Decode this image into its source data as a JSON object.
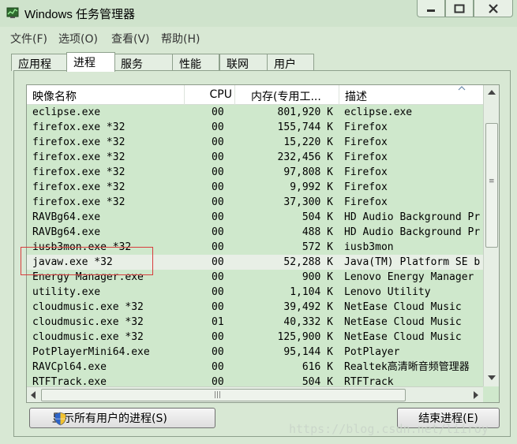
{
  "window": {
    "title": "Windows 任务管理器",
    "icon": "task-manager-icon"
  },
  "menu": [
    "文件(F)",
    "选项(O)",
    "查看(V)",
    "帮助(H)"
  ],
  "tabs": [
    "应用程序",
    "进程",
    "服务",
    "性能",
    "联网",
    "用户"
  ],
  "active_tab": "进程",
  "columns": [
    "映像名称",
    "CPU",
    "内存(专用工...",
    "描述"
  ],
  "rows": [
    {
      "name": "eclipse.exe",
      "cpu": "00",
      "mem": "801,920 K",
      "desc": "eclipse.exe"
    },
    {
      "name": "firefox.exe *32",
      "cpu": "00",
      "mem": "155,744 K",
      "desc": "Firefox"
    },
    {
      "name": "firefox.exe *32",
      "cpu": "00",
      "mem": "15,220 K",
      "desc": "Firefox"
    },
    {
      "name": "firefox.exe *32",
      "cpu": "00",
      "mem": "232,456 K",
      "desc": "Firefox"
    },
    {
      "name": "firefox.exe *32",
      "cpu": "00",
      "mem": "97,808 K",
      "desc": "Firefox"
    },
    {
      "name": "firefox.exe *32",
      "cpu": "00",
      "mem": "9,992 K",
      "desc": "Firefox"
    },
    {
      "name": "firefox.exe *32",
      "cpu": "00",
      "mem": "37,300 K",
      "desc": "Firefox"
    },
    {
      "name": "RAVBg64.exe",
      "cpu": "00",
      "mem": "504 K",
      "desc": "HD Audio Background Pr"
    },
    {
      "name": "RAVBg64.exe",
      "cpu": "00",
      "mem": "488 K",
      "desc": "HD Audio Background Pr"
    },
    {
      "name": "iusb3mon.exe *32",
      "cpu": "00",
      "mem": "572 K",
      "desc": "iusb3mon"
    },
    {
      "name": "javaw.exe *32",
      "cpu": "00",
      "mem": "52,288 K",
      "desc": "Java(TM) Platform SE b"
    },
    {
      "name": "Energy Manager.exe",
      "cpu": "00",
      "mem": "900 K",
      "desc": "Lenovo Energy Manager"
    },
    {
      "name": "utility.exe",
      "cpu": "00",
      "mem": "1,104 K",
      "desc": "Lenovo Utility"
    },
    {
      "name": "cloudmusic.exe *32",
      "cpu": "00",
      "mem": "39,492 K",
      "desc": "NetEase Cloud Music"
    },
    {
      "name": "cloudmusic.exe *32",
      "cpu": "01",
      "mem": "40,332 K",
      "desc": "NetEase Cloud Music"
    },
    {
      "name": "cloudmusic.exe *32",
      "cpu": "00",
      "mem": "125,900 K",
      "desc": "NetEase Cloud Music"
    },
    {
      "name": "PotPlayerMini64.exe",
      "cpu": "00",
      "mem": "95,144 K",
      "desc": "PotPlayer"
    },
    {
      "name": "RAVCpl64.exe",
      "cpu": "00",
      "mem": "616 K",
      "desc": "Realtek高清晰音频管理器"
    },
    {
      "name": "RTFTrack.exe",
      "cpu": "00",
      "mem": "504 K",
      "desc": "RTFTrack"
    }
  ],
  "selected_row": "javaw.exe *32",
  "buttons": {
    "show_all": "显示所有用户的进程(S)",
    "end_process": "结束进程(E)"
  },
  "watermark": "https://blog.csdn.net/liiroy",
  "colors": {
    "window_bg": "#d8e8d4",
    "list_bg": "#cfe8cc",
    "highlight_box": "#d83c3c"
  }
}
